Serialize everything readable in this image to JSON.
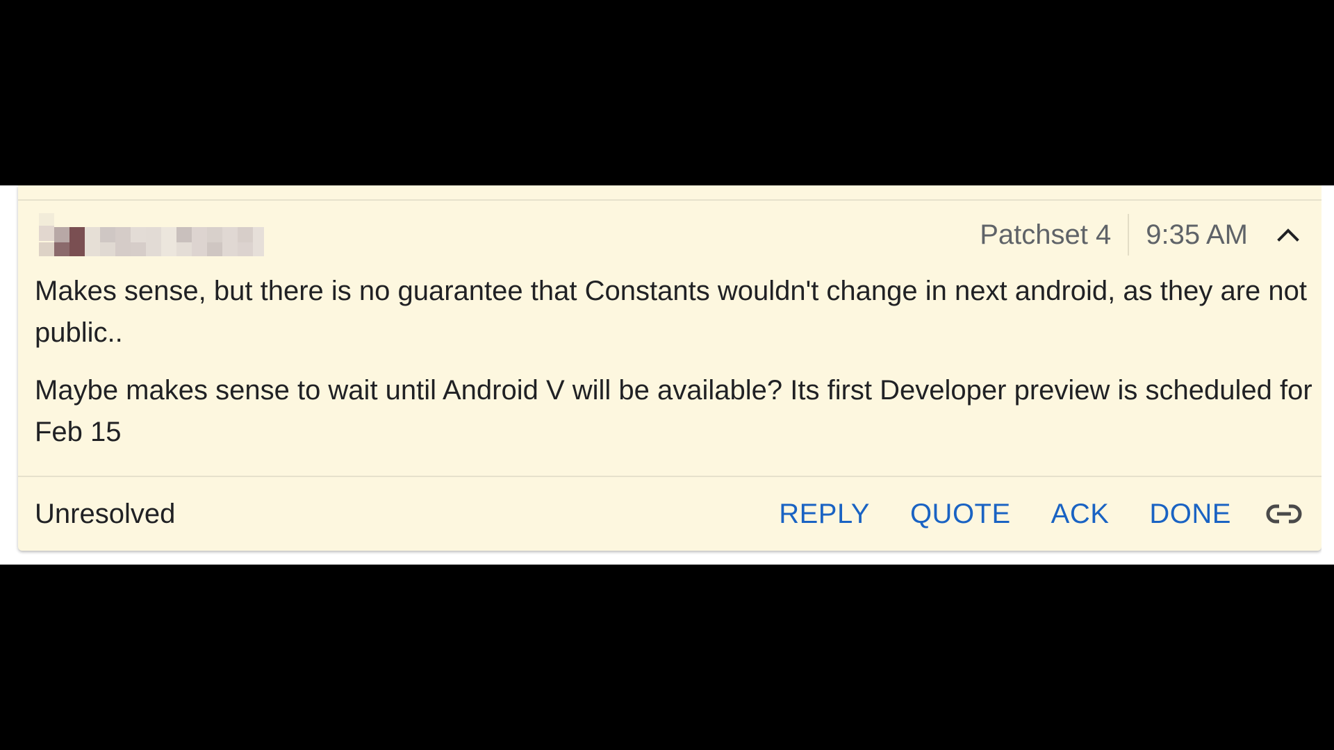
{
  "comment": {
    "patchset": "Patchset 4",
    "time": "9:35 AM",
    "paragraphs": [
      "Makes sense, but there is no guarantee that Constants wouldn't change in next android, as they are not public..",
      "Maybe makes sense to wait until Android V will be available? Its first Developer preview is scheduled for Feb 15"
    ],
    "status": "Unresolved",
    "actions": {
      "reply": "REPLY",
      "quote": "QUOTE",
      "ack": "ACK",
      "done": "DONE"
    }
  },
  "icons": {
    "collapse": "chevron-up-icon",
    "link": "link-icon"
  },
  "colors": {
    "card_background": "#fdf7df",
    "action_blue": "#1a63c3",
    "meta_gray": "#5f6368",
    "text": "#202124"
  }
}
